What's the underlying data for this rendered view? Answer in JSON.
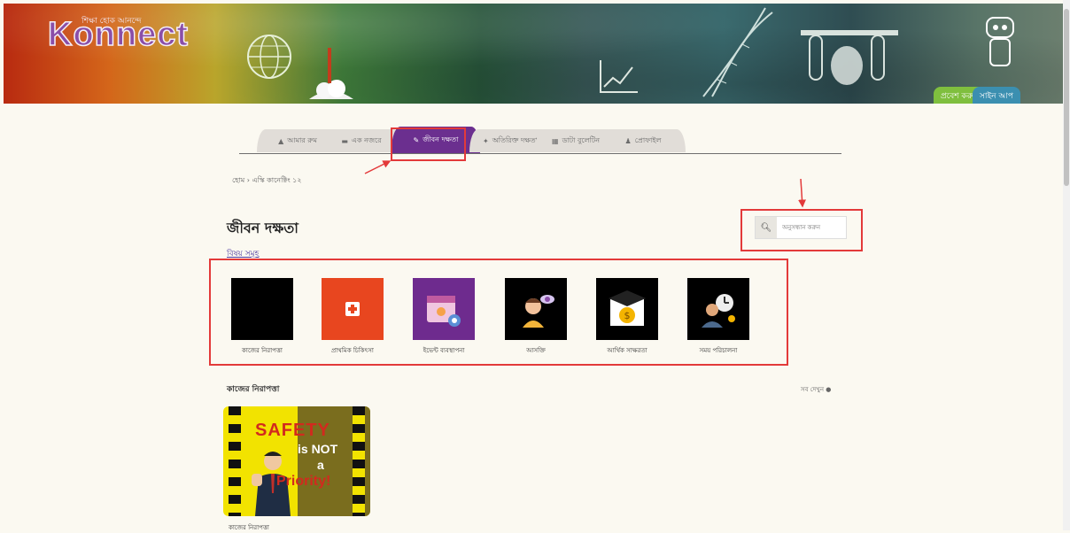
{
  "header": {
    "logo_tagline": "শিক্ষা হোক আনন্দে",
    "logo_text": "Konnect",
    "login_label": "প্রবেশ করুন",
    "signup_label": "সাইন আপ"
  },
  "tabs": [
    {
      "label": "আমার রুম",
      "icon": "user-icon"
    },
    {
      "label": "এক নজরে",
      "icon": "book-icon"
    },
    {
      "label": "জীবন দক্ষতা",
      "icon": "skill-icon",
      "active": true
    },
    {
      "label": "অতিরিক্ত দক্ষতা",
      "icon": "star-icon"
    },
    {
      "label": "ডাটা বুলেটিন",
      "icon": "document-icon"
    },
    {
      "label": "প্রোফাইল",
      "icon": "profile-icon"
    }
  ],
  "breadcrumb": "হোম › এস্কি কানেক্টিং ১২",
  "page_title": "জীবন দক্ষতা",
  "subheading": "বিষয় সমূহ",
  "search": {
    "placeholder": "অনুসন্ধান করুন"
  },
  "categories": [
    {
      "label": "কাজের নিরাপত্তা",
      "bg": "#000000",
      "icon": "blank-thumbnail"
    },
    {
      "label": "প্রাথমিক চিকিৎসা",
      "bg": "#e8461f",
      "icon": "first-aid-icon"
    },
    {
      "label": "ইভেন্ট ব্যবস্থাপনা",
      "bg": "#6e2b8e",
      "icon": "calendar-icon"
    },
    {
      "label": "আসক্তি",
      "bg": "#000000",
      "icon": "person-eye-icon"
    },
    {
      "label": "আর্থিক সাক্ষরতা",
      "bg": "#000000",
      "icon": "graduation-coin-icon"
    },
    {
      "label": "সময় পরিচালনা",
      "bg": "#000000",
      "icon": "time-person-icon"
    }
  ],
  "section": {
    "title": "কাজের নিরাপত্তা",
    "see_all": "সব দেখুন ●"
  },
  "poster": {
    "line1": "SAFETY",
    "line2": "is NOT",
    "line3": "a",
    "line4": "Priority!",
    "caption": "কাজের নিরাপত্তা"
  },
  "colors": {
    "tab_active": "#6b2f8f",
    "annotation": "#e33a3a",
    "login": "#7fbf3e",
    "signup": "#3b8fb0"
  }
}
